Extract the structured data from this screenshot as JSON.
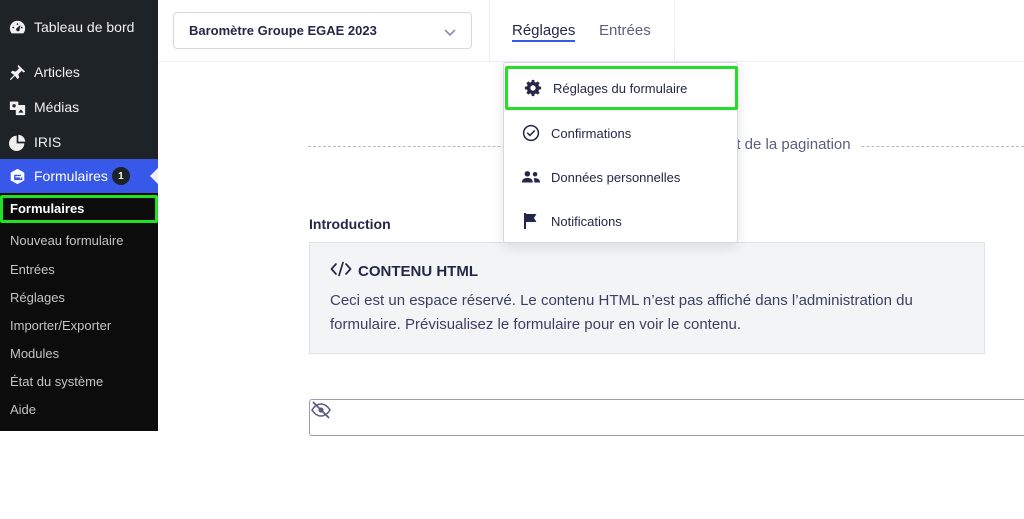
{
  "sidebar": {
    "items": [
      {
        "label": "Tableau de bord",
        "icon": "dashboard-icon"
      },
      {
        "label": "Articles",
        "icon": "pushpin-icon"
      },
      {
        "label": "Médias",
        "icon": "media-icon"
      },
      {
        "label": "IRIS",
        "icon": "pie-chart-icon"
      },
      {
        "label": "Formulaires",
        "icon": "gravity-forms-icon",
        "badge": "1"
      }
    ],
    "submenu": [
      "Formulaires",
      "Nouveau formulaire",
      "Entrées",
      "Réglages",
      "Importer/Exporter",
      "Modules",
      "État du système",
      "Aide"
    ]
  },
  "toolbar": {
    "form_selector": "Baromètre Groupe EGAE 2023",
    "tabs": [
      "Réglages",
      "Entrées"
    ]
  },
  "dropdown": {
    "items": [
      {
        "label": "Réglages du formulaire",
        "icon": "gear-icon"
      },
      {
        "label": "Confirmations",
        "icon": "check-circle-icon"
      },
      {
        "label": "Données personnelles",
        "icon": "users-icon"
      },
      {
        "label": "Notifications",
        "icon": "flag-icon"
      }
    ]
  },
  "editor": {
    "page_break_label": "ut de la pagination",
    "field_label": "Introduction",
    "html_block": {
      "title": "CONTENU HTML",
      "description": "Ceci est un espace réservé. Le contenu HTML n’est pas affiché dans l’administration du formulaire. Prévisualisez le formulaire pour en voir le contenu."
    }
  },
  "colors": {
    "sidebar_bg": "#1d2327",
    "submenu_bg": "#0c0c0c",
    "accent": "#3858e9",
    "highlight": "#22e022",
    "text": "#242748"
  }
}
